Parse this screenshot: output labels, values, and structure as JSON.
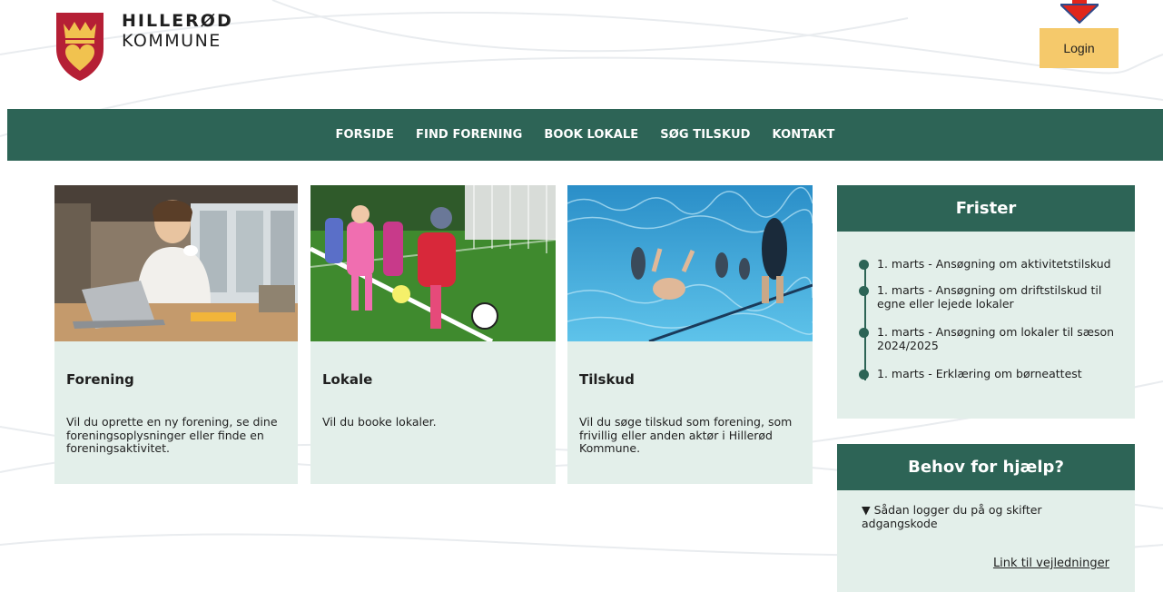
{
  "brand": {
    "line1": "HILLERØD",
    "line2": "KOMMUNE",
    "crest_color": "#b51f35",
    "crest_accent": "#f1c24f"
  },
  "header": {
    "login_label": "Login",
    "login_color": "#f5c96b",
    "pointer_icon": "arrow-down-icon",
    "pointer_color": "#e0261b"
  },
  "nav": {
    "color": "#2d6456",
    "items": [
      {
        "label": "FORSIDE"
      },
      {
        "label": "FIND FORENING"
      },
      {
        "label": "BOOK LOKALE"
      },
      {
        "label": "SØG TILSKUD"
      },
      {
        "label": "KONTAKT"
      }
    ]
  },
  "cards": [
    {
      "title": "Forening",
      "text": "Vil du oprette en ny forening, se dine foreningsoplysninger eller finde en foreningsaktivitet.",
      "image": "man-with-laptop-photo"
    },
    {
      "title": "Lokale",
      "text": "Vil du booke lokaler.",
      "image": "children-playing-football-photo"
    },
    {
      "title": "Tilskud",
      "text": "Vil du søge tilskud som forening, som frivillig eller anden aktør i Hillerød Kommune.",
      "image": "swimming-pool-photo"
    }
  ],
  "frister": {
    "title": "Frister",
    "items": [
      {
        "text": "1. marts - Ansøgning om aktivitetstilskud"
      },
      {
        "text": "1. marts - Ansøgning om driftstilskud til egne eller lejede lokaler"
      },
      {
        "text": "1. marts - Ansøgning om lokaler til sæson 2024/2025"
      },
      {
        "text": "1. marts - Erklæring om børneattest"
      }
    ]
  },
  "help": {
    "title": "Behov for hjælp?",
    "item": "▼ Sådan logger du på og skifter adgangskode",
    "link": "Link til vejledninger"
  }
}
